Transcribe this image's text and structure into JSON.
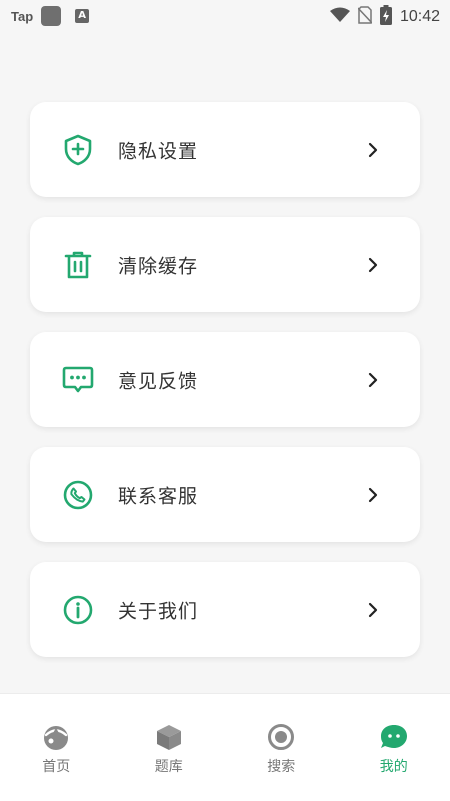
{
  "status_bar": {
    "app_label": "Tap",
    "time": "10:42"
  },
  "colors": {
    "accent": "#23a86f",
    "card_bg": "#ffffff",
    "page_bg": "#f6f6f6",
    "inactive": "#8a8a8a"
  },
  "menu": [
    {
      "label": "隐私设置",
      "icon": "shield-plus-icon"
    },
    {
      "label": "清除缓存",
      "icon": "trash-icon"
    },
    {
      "label": "意见反馈",
      "icon": "feedback-icon"
    },
    {
      "label": "联系客服",
      "icon": "phone-icon"
    },
    {
      "label": "关于我们",
      "icon": "info-icon"
    }
  ],
  "bottom_nav": {
    "items": [
      {
        "label": "首页",
        "icon": "home-icon",
        "active": false
      },
      {
        "label": "题库",
        "icon": "box-icon",
        "active": false
      },
      {
        "label": "搜索",
        "icon": "search-icon",
        "active": false
      },
      {
        "label": "我的",
        "icon": "profile-icon",
        "active": true
      }
    ]
  }
}
